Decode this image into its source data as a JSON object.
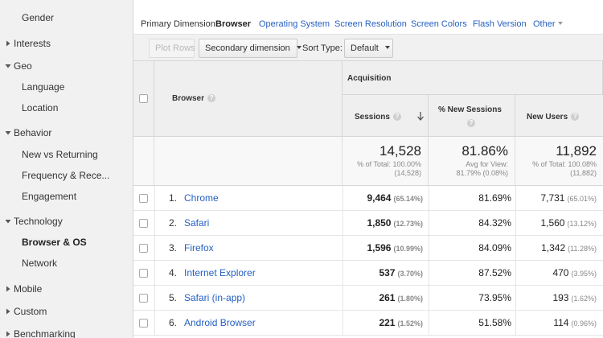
{
  "sidebar": {
    "items": [
      {
        "label": "Gender",
        "kind": "child"
      },
      {
        "label": "Interests",
        "kind": "parent",
        "expanded": false
      },
      {
        "label": "Geo",
        "kind": "parent",
        "expanded": true
      },
      {
        "label": "Language",
        "kind": "child"
      },
      {
        "label": "Location",
        "kind": "child"
      },
      {
        "label": "Behavior",
        "kind": "parent",
        "expanded": true
      },
      {
        "label": "New vs Returning",
        "kind": "child"
      },
      {
        "label": "Frequency & Rece...",
        "kind": "child"
      },
      {
        "label": "Engagement",
        "kind": "child"
      },
      {
        "label": "Technology",
        "kind": "parent",
        "expanded": true
      },
      {
        "label": "Browser & OS",
        "kind": "child",
        "active": true
      },
      {
        "label": "Network",
        "kind": "child"
      },
      {
        "label": "Mobile",
        "kind": "parent",
        "expanded": false
      },
      {
        "label": "Custom",
        "kind": "parent",
        "expanded": false
      },
      {
        "label": "Benchmarking",
        "kind": "parent",
        "expanded": false
      }
    ]
  },
  "dimensions": {
    "label": "Primary Dimension:",
    "current": "Browser",
    "links": [
      "Operating System",
      "Screen Resolution",
      "Screen Colors",
      "Flash Version",
      "Other"
    ]
  },
  "toolbar": {
    "plot_rows": "Plot Rows",
    "secondary": "Secondary dimension",
    "sort_label": "Sort Type:",
    "sort_value": "Default"
  },
  "table": {
    "headers": {
      "browser": "Browser",
      "group": "Acquisition",
      "sessions": "Sessions",
      "new_sessions": "% New Sessions",
      "new_users": "New Users"
    },
    "totals": {
      "sessions": {
        "value": "14,528",
        "line1": "% of Total: 100.00%",
        "line2": "(14,528)"
      },
      "new_sessions": {
        "value": "81.86%",
        "line1": "Avg for View:",
        "line2": "81.79% (0.08%)"
      },
      "new_users": {
        "value": "11,892",
        "line1": "% of Total: 100.08%",
        "line2": "(11,882)"
      }
    },
    "rows": [
      {
        "num": "1.",
        "browser": "Chrome",
        "sessions": "9,464",
        "sessions_pct": "(65.14%)",
        "new_sessions": "81.69%",
        "new_users": "7,731",
        "new_users_pct": "(65.01%)"
      },
      {
        "num": "2.",
        "browser": "Safari",
        "sessions": "1,850",
        "sessions_pct": "(12.73%)",
        "new_sessions": "84.32%",
        "new_users": "1,560",
        "new_users_pct": "(13.12%)"
      },
      {
        "num": "3.",
        "browser": "Firefox",
        "sessions": "1,596",
        "sessions_pct": "(10.99%)",
        "new_sessions": "84.09%",
        "new_users": "1,342",
        "new_users_pct": "(11.28%)"
      },
      {
        "num": "4.",
        "browser": "Internet Explorer",
        "sessions": "537",
        "sessions_pct": "(3.70%)",
        "new_sessions": "87.52%",
        "new_users": "470",
        "new_users_pct": "(3.95%)"
      },
      {
        "num": "5.",
        "browser": "Safari (in-app)",
        "sessions": "261",
        "sessions_pct": "(1.80%)",
        "new_sessions": "73.95%",
        "new_users": "193",
        "new_users_pct": "(1.62%)"
      },
      {
        "num": "6.",
        "browser": "Android Browser",
        "sessions": "221",
        "sessions_pct": "(1.52%)",
        "new_sessions": "51.58%",
        "new_users": "114",
        "new_users_pct": "(0.96%)"
      }
    ]
  },
  "colors": {
    "link": "#2561c2",
    "header_bg": "#efefef",
    "sidebar_bg": "#f1f1f1"
  }
}
